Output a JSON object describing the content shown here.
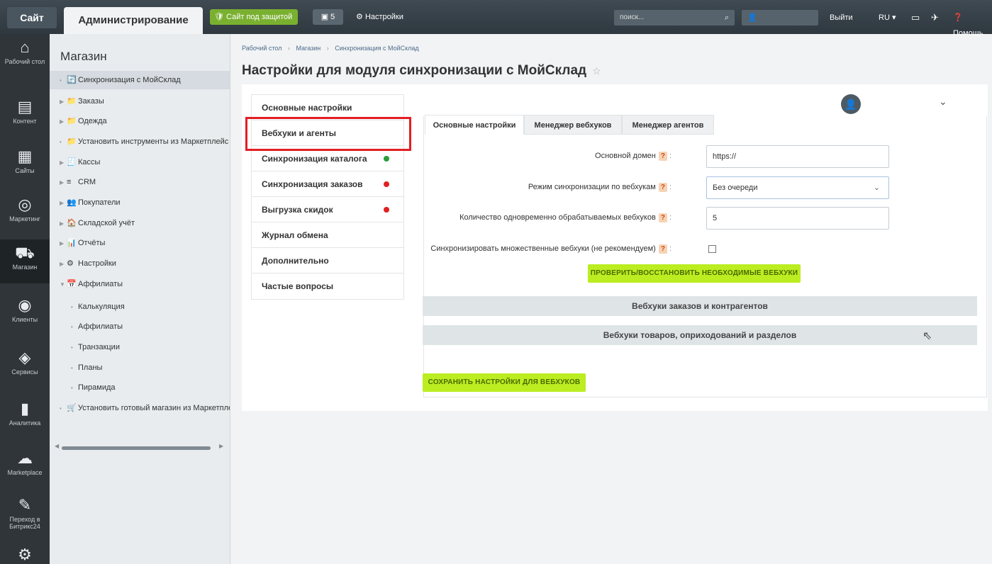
{
  "topbar": {
    "site_tab": "Сайт",
    "admin_tab": "Администрирование",
    "protected_label": "Сайт под защитой",
    "notifications_count": "5",
    "settings_label": "Настройки",
    "search_placeholder": "поиск...",
    "user_name": "",
    "logout_label": "Выйти",
    "lang_label": "RU",
    "help_label": "Помощь"
  },
  "leftnav": [
    {
      "label": "Рабочий стол",
      "icon": "home-icon"
    },
    {
      "label": "Контент",
      "icon": "document-icon"
    },
    {
      "label": "Сайты",
      "icon": "sites-icon"
    },
    {
      "label": "Маркетинг",
      "icon": "target-icon"
    },
    {
      "label": "Магазин",
      "icon": "shop-icon"
    },
    {
      "label": "Клиенты",
      "icon": "clients-icon"
    },
    {
      "label": "Сервисы",
      "icon": "layers-icon"
    },
    {
      "label": "Аналитика",
      "icon": "chart-icon"
    },
    {
      "label": "Marketplace",
      "icon": "cloud-icon"
    },
    {
      "label": "Переход в Битрикс24",
      "icon": "bitrix-icon"
    },
    {
      "label": "",
      "icon": "gear-icon"
    }
  ],
  "tree": {
    "title": "Магазин",
    "items": [
      {
        "label": "Синхронизация с МойСклад"
      },
      {
        "label": "Заказы"
      },
      {
        "label": "Одежда"
      },
      {
        "label": "Установить инструменты из Маркетплейс"
      },
      {
        "label": "Кассы"
      },
      {
        "label": "CRM"
      },
      {
        "label": "Покупатели"
      },
      {
        "label": "Складской учёт"
      },
      {
        "label": "Отчёты"
      },
      {
        "label": "Настройки"
      },
      {
        "label": "Аффилиаты"
      },
      {
        "label": "Калькуляция"
      },
      {
        "label": "Аффилиаты"
      },
      {
        "label": "Транзакции"
      },
      {
        "label": "Планы"
      },
      {
        "label": "Пирамида"
      },
      {
        "label": "Установить готовый магазин из Маркетпле"
      }
    ]
  },
  "breadcrumb": {
    "items": [
      "Рабочий стол",
      "Магазин",
      "Синхронизация с МойСклад"
    ]
  },
  "page_title": "Настройки для модуля синхронизации с МойСклад",
  "profile": {
    "name": ""
  },
  "vtabs": [
    {
      "label": "Основные настройки",
      "status": null
    },
    {
      "label": "Вебхуки и агенты",
      "status": null
    },
    {
      "label": "Синхронизация каталога",
      "status": "#2a9d3a"
    },
    {
      "label": "Синхронизация заказов",
      "status": "#e02020"
    },
    {
      "label": "Выгрузка скидок",
      "status": "#e02020"
    },
    {
      "label": "Журнал обмена",
      "status": null
    },
    {
      "label": "Дополнительно",
      "status": null
    },
    {
      "label": "Частые вопросы",
      "status": null
    }
  ],
  "htabs": [
    "Основные настройки",
    "Менеджер вебхуков",
    "Менеджер агентов"
  ],
  "form": {
    "domain_label": "Основной домен",
    "domain_value": "https://",
    "mode_label": "Режим синхронизации по вебхукам",
    "mode_value": "Без очереди",
    "count_label": "Количество одновременно обрабатываемых вебхуков",
    "count_value": "5",
    "multi_label": "Синхронизировать множественные вебхуки (не рекомендуем)",
    "help_mark": "?",
    "check_button": "ПРОВЕРИТЬ/ВОССТАНОВИТЬ НЕОБХОДИМЫЕ ВЕБХУКИ",
    "accordion_orders": "Вебхуки заказов и контрагентов",
    "accordion_goods": "Вебхуки товаров, оприходований и разделов",
    "save_button": "СОХРАНИТЬ НАСТРОЙКИ ДЛЯ ВЕБХУКОВ"
  },
  "colors": {
    "accent_green": "#bbed21",
    "highlight_red": "#e31e24",
    "topbar": "#39434b"
  }
}
